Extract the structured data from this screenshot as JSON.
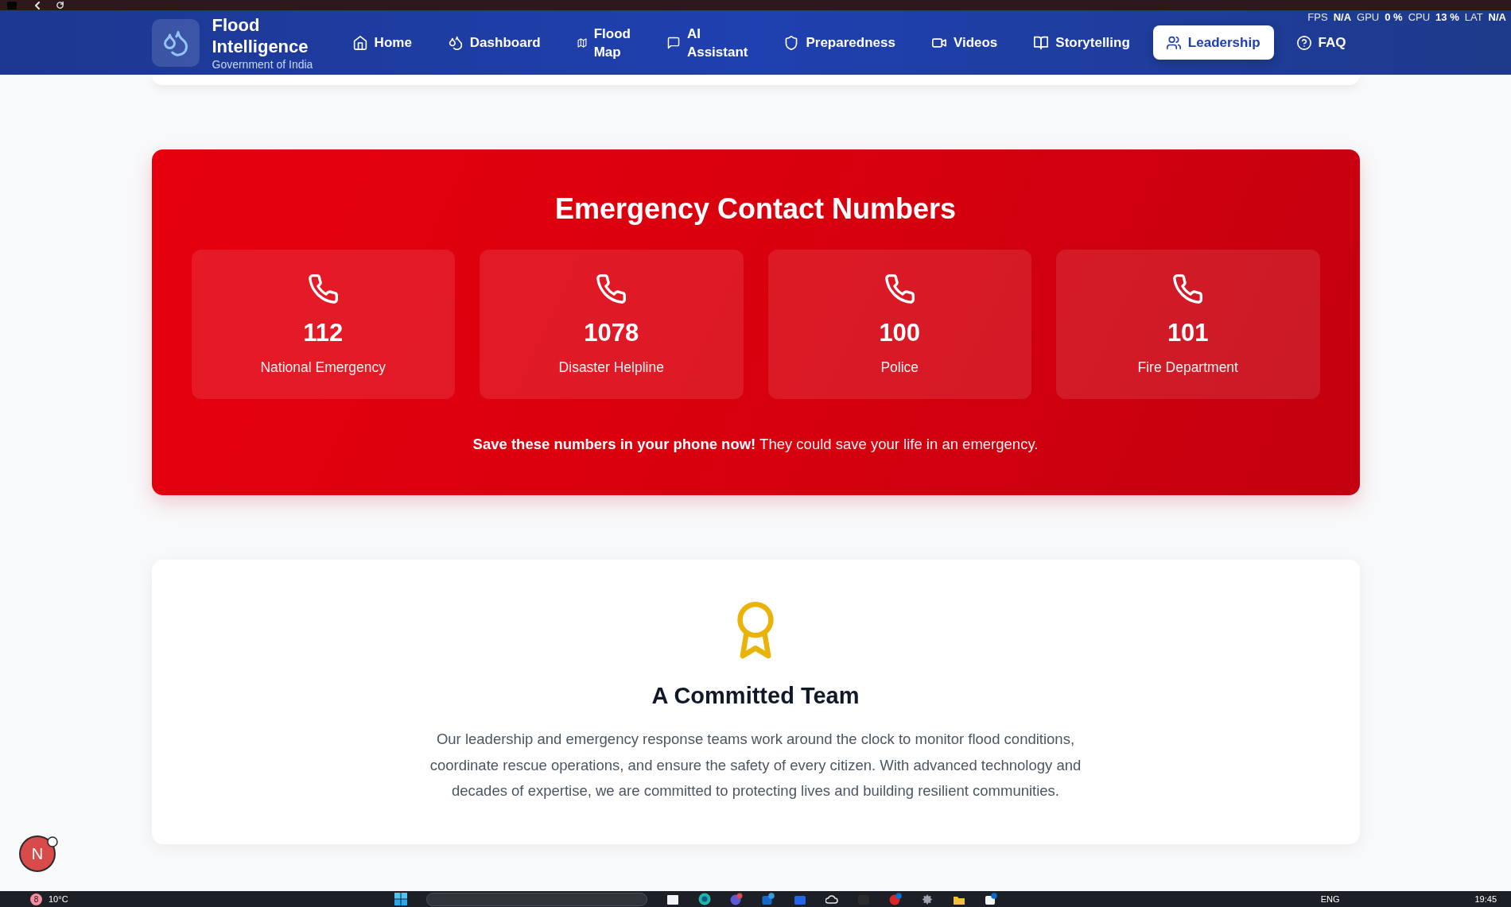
{
  "perf_overlay": [
    {
      "label": "FPS",
      "value": "N/A"
    },
    {
      "label": "GPU",
      "value": "0 %"
    },
    {
      "label": "CPU",
      "value": "13 %"
    },
    {
      "label": "LAT",
      "value": "N/A"
    }
  ],
  "navbar": {
    "brand": {
      "title": "Flood Intelligence",
      "subtitle": "Government of India"
    },
    "items": [
      {
        "label": "Home",
        "selected": false
      },
      {
        "label": "Dashboard",
        "selected": false
      },
      {
        "label": "Flood Map",
        "selected": false
      },
      {
        "label": "AI Assistant",
        "selected": false
      },
      {
        "label": "Preparedness",
        "selected": false
      },
      {
        "label": "Videos",
        "selected": false
      },
      {
        "label": "Storytelling",
        "selected": false
      },
      {
        "label": "Leadership",
        "selected": true
      },
      {
        "label": "FAQ",
        "selected": false
      }
    ]
  },
  "emergency": {
    "title": "Emergency Contact Numbers",
    "contacts": [
      {
        "number": "112",
        "label": "National Emergency"
      },
      {
        "number": "1078",
        "label": "Disaster Helpline"
      },
      {
        "number": "100",
        "label": "Police"
      },
      {
        "number": "101",
        "label": "Fire Department"
      }
    ],
    "note": "**Save these numbers in your phone now!** They could save your life in an emergency."
  },
  "team": {
    "title": "A Committed Team",
    "text": "Our leadership and emergency response teams work around the clock to monitor flood conditions, coordinate rescue operations, and ensure the safety of every citizen. With advanced technology and decades of expertise, we are committed to protecting lives and building resilient communities."
  },
  "chat_avatar": {
    "initial": "N"
  },
  "taskbar": {
    "weather_badge": "8",
    "temperature": "10°C",
    "language": "ENG",
    "time": "19:45"
  }
}
